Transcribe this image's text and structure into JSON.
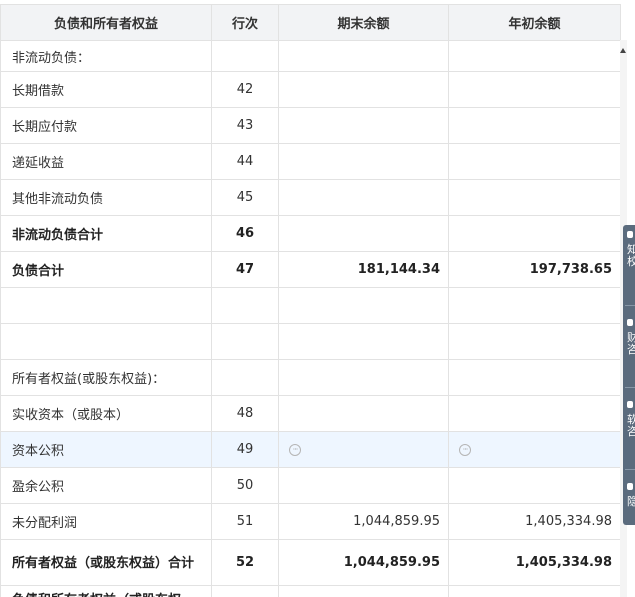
{
  "table": {
    "headers": [
      "负债和所有者权益",
      "行次",
      "期末余额",
      "年初余额"
    ],
    "rows": [
      {
        "name": "非流动负债：",
        "line": "",
        "end": "",
        "begin": ""
      },
      {
        "name": "长期借款",
        "line": "42",
        "end": "",
        "begin": ""
      },
      {
        "name": "长期应付款",
        "line": "43",
        "end": "",
        "begin": ""
      },
      {
        "name": "递延收益",
        "line": "44",
        "end": "",
        "begin": ""
      },
      {
        "name": "其他非流动负债",
        "line": "45",
        "end": "",
        "begin": ""
      },
      {
        "name": "非流动负债合计",
        "line": "46",
        "end": "",
        "begin": ""
      },
      {
        "name": "负债合计",
        "line": "47",
        "end": "181,144.34",
        "begin": "197,738.65"
      },
      {
        "name": "",
        "line": "",
        "end": "",
        "begin": ""
      },
      {
        "name": "",
        "line": "",
        "end": "",
        "begin": ""
      },
      {
        "name": "所有者权益(或股东权益)：",
        "line": "",
        "end": "",
        "begin": ""
      },
      {
        "name": "实收资本（或股本）",
        "line": "48",
        "end": "",
        "begin": ""
      },
      {
        "name": "资本公积",
        "line": "49",
        "end": "",
        "begin": ""
      },
      {
        "name": "盈余公积",
        "line": "50",
        "end": "",
        "begin": ""
      },
      {
        "name": "未分配利润",
        "line": "51",
        "end": "1,044,859.95",
        "begin": "1,405,334.98"
      },
      {
        "name": "所有者权益（或股东权益）合计",
        "line": "52",
        "end": "1,044,859.95",
        "begin": "1,405,334.98"
      },
      {
        "name": "负债和所有者权益（或股东权",
        "line": "",
        "end": "",
        "begin": ""
      }
    ]
  },
  "row_icons": {
    "capital_reserve_end": "ellipsis-circle-icon",
    "capital_reserve_begin": "ellipsis-circle-icon"
  },
  "side_panel": {
    "items": [
      {
        "icon": "book-icon",
        "label": "知\n校"
      },
      {
        "icon": "person-icon",
        "label": "财\n咨"
      },
      {
        "icon": "chat-icon",
        "label": "软\n咨"
      },
      {
        "icon": "headset-icon",
        "label": "隐"
      }
    ],
    "bg_color": "#5b6b7d"
  },
  "colors": {
    "header_bg": "#f2f3f5",
    "highlight_row": "#eef6ff",
    "border": "#e2e2e2"
  }
}
